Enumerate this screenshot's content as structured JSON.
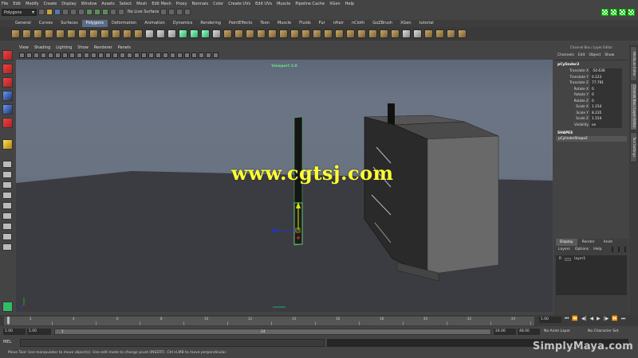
{
  "menubar": [
    "File",
    "Edit",
    "Modify",
    "Create",
    "Display",
    "Window",
    "Assets",
    "Select",
    "Mesh",
    "Edit Mesh",
    "Proxy",
    "Normals",
    "Color",
    "Create UVs",
    "Edit UVs",
    "Muscle",
    "Pipeline Cache",
    "XGen",
    "Help"
  ],
  "statusline": {
    "mode_value": "Polygons",
    "live_surface_label": "No Live Surface"
  },
  "shelf_tabs": [
    "General",
    "Curves",
    "Surfaces",
    "Polygons",
    "Deformation",
    "Animation",
    "Dynamics",
    "Rendering",
    "PaintEffects",
    "Toon",
    "Muscle",
    "Fluids",
    "Fur",
    "nHair",
    "nCloth",
    "GoZBrush",
    "XGen",
    "tutorial"
  ],
  "active_shelf_tab": "Polygons",
  "viewport_menu": [
    "View",
    "Shading",
    "Lighting",
    "Show",
    "Renderer",
    "Panels"
  ],
  "viewport_title": "Viewport 2.0",
  "watermark": "www.cgtsj.com",
  "channel_box": {
    "header": "Channel Box / Layer Editor",
    "menu": [
      "Channels",
      "Edit",
      "Object",
      "Show"
    ],
    "object_name": "pCylinder2",
    "attributes": [
      {
        "name": "Translate X",
        "value": "-54.636"
      },
      {
        "name": "Translate Y",
        "value": "0.123"
      },
      {
        "name": "Translate Z",
        "value": "77.791"
      },
      {
        "name": "Rotate X",
        "value": "0"
      },
      {
        "name": "Rotate Y",
        "value": "0"
      },
      {
        "name": "Rotate Z",
        "value": "0"
      },
      {
        "name": "Scale X",
        "value": "1.154"
      },
      {
        "name": "Scale Y",
        "value": "8.235"
      },
      {
        "name": "Scale Z",
        "value": "1.154"
      },
      {
        "name": "Visibility",
        "value": "on"
      }
    ],
    "shapes_header": "SHAPES",
    "shape_name": "pCylinderShape2"
  },
  "layer_editor": {
    "tabs": [
      "Display",
      "Render",
      "Anim"
    ],
    "active_tab": "Display",
    "menu": [
      "Layers",
      "Options",
      "Help"
    ],
    "layer_flag": "R",
    "layer_name": "layer1"
  },
  "side_tabs": [
    "Attribute Editor",
    "Channel Box / Layer Editor",
    "Tool Settings"
  ],
  "timeslider": {
    "ticks": [
      "1",
      "2",
      "4",
      "6",
      "8",
      "10",
      "12",
      "14",
      "16",
      "18",
      "20",
      "22",
      "24"
    ],
    "current_frame": "1.00"
  },
  "range": {
    "start": "1.00",
    "start_inner": "1.00",
    "slider_start": "1",
    "slider_end": "24",
    "end_inner": "24.00",
    "end": "48.00",
    "anim_layer": "No Anim Layer",
    "character_set": "No Character Set"
  },
  "cmdline_label": "MEL",
  "helpline": "Move Tool: Use manipulator to move object(s). Use edit mode to change pivot (INSERT). Ctrl+LMB to move perpendicular.",
  "brand": "SimplyMaya.com"
}
